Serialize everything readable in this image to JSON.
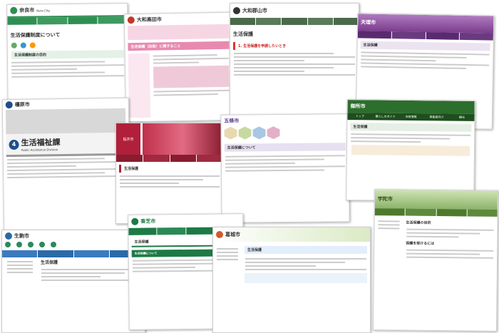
{
  "shots": {
    "nara": {
      "name": "奈良市",
      "sub": "Nara City",
      "title": "生活保護制度について",
      "section": "生活保護制度の目的"
    },
    "yamatotakada": {
      "name": "大和高田市",
      "title": "生活保護（扶助）に関すること"
    },
    "yamatokoriyama": {
      "name": "大和郡山市",
      "title": "生活保護",
      "item": "1. 生活保護を申請したいとき"
    },
    "tenri": {
      "name": "天理市",
      "title": "生活保護"
    },
    "kashihara": {
      "name": "橿原市",
      "sign_number": "4",
      "sign_jp": "生活福祉課",
      "sign_en": "Public Assistance Division"
    },
    "sakurai": {
      "name": "桜井市",
      "title": "生活保護"
    },
    "gojo": {
      "name": "五條市",
      "title": "生活保護について"
    },
    "gose": {
      "name": "御所市",
      "title": "生活保護",
      "nav": [
        "トップ",
        "暮らしのガイド",
        "市政情報",
        "事業者向け",
        "観光"
      ]
    },
    "ikoma": {
      "name": "生駒市",
      "title": "生活保護"
    },
    "kashiba": {
      "name": "香芝市",
      "title": "生活保護",
      "sub": "生活保護について"
    },
    "katsuragi": {
      "name": "葛城市",
      "title": "生活保護"
    },
    "uda": {
      "name": "宇陀市",
      "title": "生活保護の目的",
      "sub": "保護を受けるには"
    }
  },
  "colors": {
    "nara_green": "#2f8f52",
    "kashihara_blue": "#1f4e8c",
    "sakurai_red": "#b0203a",
    "gojo_purple": "#5b3d8c",
    "gose_green": "#2c6e2c",
    "tenri_purple": "#7a3d8c",
    "kashiba_green": "#1c7a45",
    "uda_green": "#4d7a2c"
  }
}
